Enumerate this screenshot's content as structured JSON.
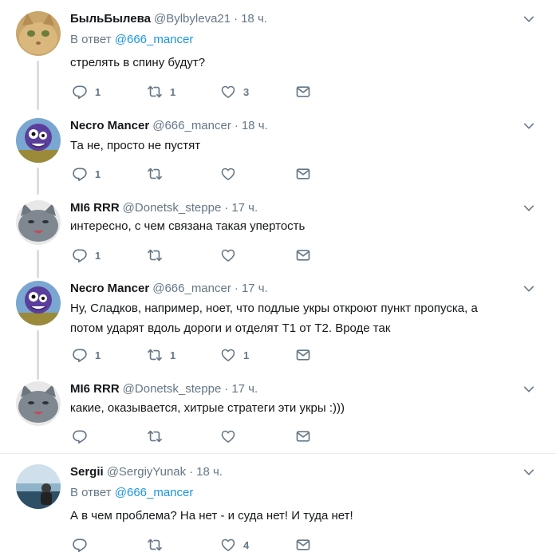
{
  "tweets": [
    {
      "name": "БыльБылева",
      "handle": "@Bylbyleva21",
      "time": "18 ч.",
      "reply_prefix": "В ответ",
      "reply_to": "@666_mancer",
      "text": "стрелять в спину будут?",
      "replies": "1",
      "retweets": "1",
      "likes": "3",
      "avatar": "cat-face-avatar"
    },
    {
      "name": "Necro Mancer",
      "handle": "@666_mancer",
      "time": "18 ч.",
      "text": "Та не, просто не пустят",
      "replies": "1",
      "retweets": "",
      "likes": "",
      "avatar": "purple-monster-avatar"
    },
    {
      "name": "MI6 RRR",
      "handle": "@Donetsk_steppe",
      "time": "17 ч.",
      "text": "интересно, с чем связана такая упертость",
      "replies": "1",
      "retweets": "",
      "likes": "",
      "avatar": "gray-cat-avatar"
    },
    {
      "name": "Necro Mancer",
      "handle": "@666_mancer",
      "time": "17 ч.",
      "text_line1": "Ну, Сладков, например, ноет, что подлые укры откроют пункт пропуска, а",
      "text_line2": "потом ударят вдоль дороги и отделят Т1 от Т2. Вроде так",
      "replies": "1",
      "retweets": "1",
      "likes": "1",
      "avatar": "purple-monster-avatar"
    },
    {
      "name": "MI6 RRR",
      "handle": "@Donetsk_steppe",
      "time": "17 ч.",
      "text": "какие, оказывается, хитрые стратеги эти укры :)))",
      "replies": "",
      "retweets": "",
      "likes": "",
      "avatar": "gray-cat-avatar"
    },
    {
      "name": "Sergii",
      "handle": "@SergiyYunak",
      "time": "18 ч.",
      "reply_prefix": "В ответ",
      "reply_to": "@666_mancer",
      "text": "А в чем проблема? На нет - и суда нет! И туда нет!",
      "replies": "",
      "retweets": "",
      "likes": "4",
      "avatar": "person-photo-avatar"
    }
  ],
  "colors": {
    "text": "#14171a",
    "muted": "#657786",
    "link": "#1b95e0",
    "thread_line": "#d8dee3",
    "divider": "#e6ecf0"
  },
  "icons": [
    "reply-icon",
    "retweet-icon",
    "like-icon",
    "direct-message-icon",
    "chevron-down-icon"
  ]
}
